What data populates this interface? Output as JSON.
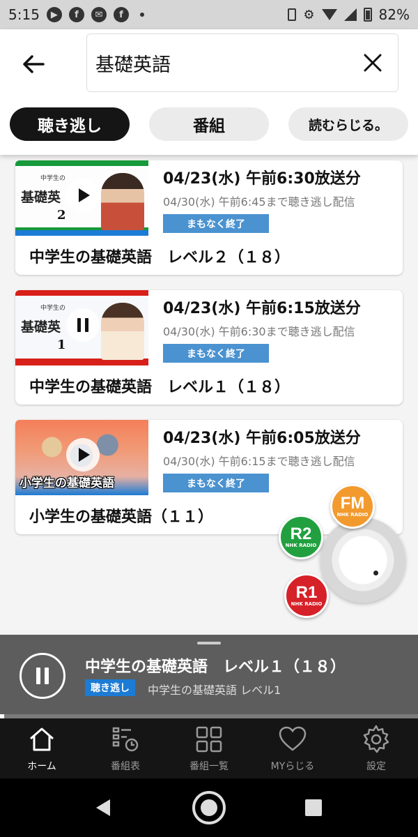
{
  "status_bar": {
    "time": "5:15",
    "battery": "82%"
  },
  "header": {
    "search_query": "基礎英語"
  },
  "tabs": [
    {
      "label": "聴き逃し",
      "active": true
    },
    {
      "label": "番組",
      "active": false
    },
    {
      "label": "読むらじる。",
      "active": false
    }
  ],
  "results": [
    {
      "thumb_small": "中学生の",
      "thumb_logo": "基礎英",
      "thumb_level": "2",
      "playing": false,
      "date": "04/23(水) 午前6:30放送分",
      "deadline": "04/30(水) 午前6:45まで聴き逃し配信",
      "badge": "まもなく終了",
      "title": "中学生の基礎英語　レベル２（１８）"
    },
    {
      "thumb_small": "中学生の",
      "thumb_logo": "基礎英",
      "thumb_level": "1",
      "playing": true,
      "date": "04/23(水) 午前6:15放送分",
      "deadline": "04/30(水) 午前6:30まで聴き逃し配信",
      "badge": "まもなく終了",
      "title": "中学生の基礎英語　レベル１（１８）"
    },
    {
      "thumb_small": "",
      "thumb_logo": "小学生の基礎英語",
      "thumb_level": "",
      "playing": false,
      "date": "04/23(水) 午前6:05放送分",
      "deadline": "04/30(水) 午前6:15まで聴き逃し配信",
      "badge": "まもなく終了",
      "title": "小学生の基礎英語（１１）"
    }
  ],
  "radio_widget": {
    "fm": {
      "name": "FM",
      "sub": "NHK RADIO",
      "color": "#f29a2e"
    },
    "r2": {
      "name": "R2",
      "sub": "NHK RADIO",
      "color": "#22a040"
    },
    "r1": {
      "name": "R1",
      "sub": "NHK RADIO",
      "color": "#d62128"
    }
  },
  "now_playing": {
    "title": "中学生の基礎英語　レベル１（１８）",
    "badge": "聴き逃し",
    "subtitle": "中学生の基礎英語 レベル1",
    "progress": 0.01
  },
  "bottom_nav": [
    {
      "label": "ホーム",
      "icon": "home-icon",
      "active": true
    },
    {
      "label": "番組表",
      "icon": "schedule-icon",
      "active": false
    },
    {
      "label": "番組一覧",
      "icon": "grid-icon",
      "active": false
    },
    {
      "label": "MYらじる",
      "icon": "heart-icon",
      "active": false
    },
    {
      "label": "設定",
      "icon": "settings-icon",
      "active": false
    }
  ]
}
